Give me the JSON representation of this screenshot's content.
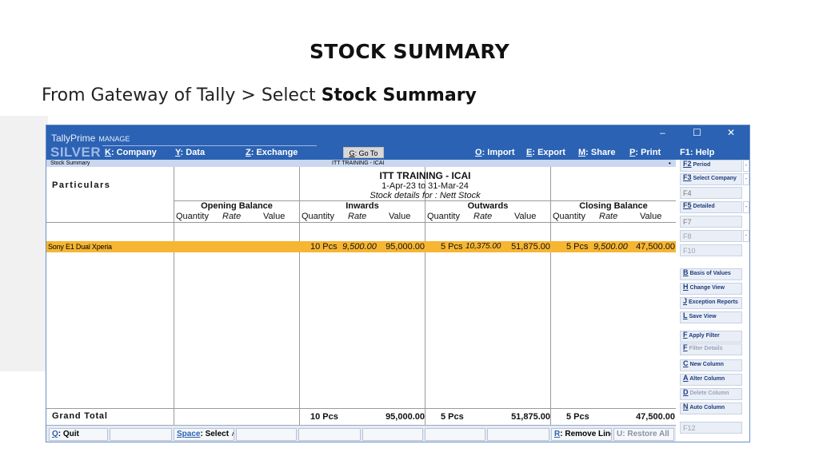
{
  "slide": {
    "title": "STOCK SUMMARY",
    "subtitle_prefix": "From Gateway of Tally > Select ",
    "subtitle_bold": "Stock Summary"
  },
  "app": {
    "brand_line1": "TallyPrime",
    "brand_tag": "MANAGE",
    "edition": "SILVER",
    "menu": [
      {
        "key": "K",
        "label": ": Company"
      },
      {
        "key": "Y",
        "label": ": Data"
      },
      {
        "key": "Z",
        "label": ": Exchange"
      },
      {
        "key": "G",
        "label": ": Go To"
      },
      {
        "key": "O",
        "label": ": Import"
      },
      {
        "key": "E",
        "label": ": Export"
      },
      {
        "key": "M",
        "label": ": Share"
      },
      {
        "key": "P",
        "label": ": Print"
      },
      {
        "key": "F1",
        "label": ": Help"
      }
    ],
    "window_controls": {
      "minimize": "–",
      "maximize": "☐",
      "close": "✕"
    }
  },
  "report": {
    "bar_left": "Stock Summary",
    "bar_center": "ITT TRAINING - ICAI",
    "bar_right": "•",
    "particulars_label": "Particulars",
    "company": "ITT TRAINING - ICAI",
    "period": "1-Apr-23 to 31-Mar-24",
    "stock_details": "Stock details for : Nett Stock",
    "groups": [
      "Opening Balance",
      "Inwards",
      "Outwards",
      "Closing Balance"
    ],
    "col_quantity": "Quantity",
    "col_rate": "Rate",
    "col_value": "Value",
    "rows": [
      {
        "name": "Sony E1 Dual Xperia",
        "opening": {
          "qty": "",
          "rate": "",
          "value": ""
        },
        "inwards": {
          "qty": "10 Pcs",
          "rate": "9,500.00",
          "value": "95,000.00"
        },
        "outwards": {
          "qty": "5 Pcs",
          "rate": "10,375.00",
          "value": "51,875.00"
        },
        "closing": {
          "qty": "5 Pcs",
          "rate": "9,500.00",
          "value": "47,500.00"
        }
      }
    ],
    "grand_total": {
      "label": "Grand Total",
      "inwards_qty": "10 Pcs",
      "inwards_value": "95,000.00",
      "outwards_qty": "5 Pcs",
      "outwards_value": "51,875.00",
      "closing_qty": "5 Pcs",
      "closing_value": "47,500.00"
    }
  },
  "sidebar": [
    {
      "key": "F2",
      "label": "Period"
    },
    {
      "key": "F3",
      "label": "Select Company"
    },
    {
      "key": "F4",
      "label": ""
    },
    {
      "key": "F5",
      "label": "Detailed"
    },
    {
      "key": "F7",
      "label": ""
    },
    {
      "key": "F8",
      "label": ""
    },
    {
      "key": "F10",
      "label": ""
    },
    {
      "key": "B",
      "label": "Basis of Values"
    },
    {
      "key": "H",
      "label": "Change View"
    },
    {
      "key": "J",
      "label": "Exception Reports"
    },
    {
      "key": "L",
      "label": "Save View"
    },
    {
      "key": "F",
      "label": "Apply Filter"
    },
    {
      "key": "F",
      "label": "Filter Details"
    },
    {
      "key": "C",
      "label": "New Column"
    },
    {
      "key": "A",
      "label": "Alter Column"
    },
    {
      "key": "D",
      "label": "Delete Column"
    },
    {
      "key": "N",
      "label": "Auto Column"
    },
    {
      "key": "F12",
      "label": ""
    }
  ],
  "bottom": {
    "quit": {
      "key": "Q",
      "label": ": Quit"
    },
    "select": {
      "key": "Space",
      "label": ": Select",
      "arrow": "∧"
    },
    "remove": {
      "key": "R",
      "label": ": Remove Line"
    },
    "restore": {
      "key": "U",
      "label": ": Restore All"
    }
  }
}
